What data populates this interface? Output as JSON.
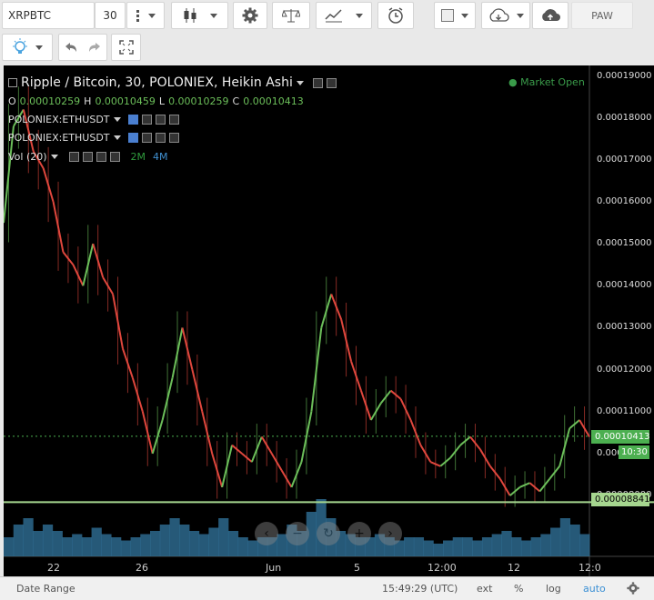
{
  "toolbar": {
    "symbol": "XRPBTC",
    "interval": "30",
    "profile": "PAW"
  },
  "legend": {
    "title": "Ripple / Bitcoin, 30, POLONIEX, Heikin Ashi",
    "ohlc": {
      "o_label": "O",
      "o": "0.00010259",
      "h_label": "H",
      "h": "0.00010459",
      "l_label": "L",
      "l": "0.00010259",
      "c_label": "C",
      "c": "0.00010413"
    },
    "market_status": "Market Open",
    "comparison1": "POLONIEX:ETHUSDT",
    "comparison2": "POLONIEX:ETHUSDT",
    "volume": "Vol (20)",
    "vol_2m": "2M",
    "vol_4m": "4M"
  },
  "price_axis": {
    "labels": [
      "0.00019000",
      "0.00018000",
      "0.00017000",
      "0.00016000",
      "0.00015000",
      "0.00014000",
      "0.00013000",
      "0.00012000",
      "0.00011000",
      "0.000",
      "0.00008000"
    ],
    "last_price": "0.00010413",
    "countdown": "10:30",
    "hline_price": "0.00008841"
  },
  "time_axis": {
    "labels": [
      "22",
      "26",
      "Jun",
      "5",
      "12:00",
      "12",
      "12:0"
    ]
  },
  "bottom": {
    "date_range": "Date Range",
    "clock": "15:49:29 (UTC)",
    "ext": "ext",
    "percent": "%",
    "log": "log",
    "auto": "auto"
  },
  "colors": {
    "up": "#6cbf5a",
    "down": "#e0473d",
    "accent": "#4a7fd0",
    "hline": "#a6d68f",
    "volume": "#2f6f96"
  },
  "chart_data": {
    "type": "line",
    "title": "Ripple / Bitcoin, 30, POLONIEX, Heikin Ashi",
    "xlabel": "",
    "ylabel": "",
    "ylim": [
      7.55e-05,
      0.0001925
    ],
    "x_ticks": [
      "22",
      "26",
      "Jun",
      "5",
      "12:00",
      "12",
      "12:0"
    ],
    "series": [
      {
        "values": [
          0.000155,
          0.000178,
          0.000182,
          0.000172,
          0.000168,
          0.00016,
          0.000148,
          0.000145,
          0.00014,
          0.00015,
          0.000142,
          0.000138,
          0.000125,
          0.000118,
          0.00011,
          0.0001,
          0.000108,
          0.000118,
          0.00013,
          0.00012,
          0.00011,
          0.0001,
          9.2e-05,
          0.000102,
          0.0001,
          9.8e-05,
          0.000104,
          0.0001,
          9.6e-05,
          9.2e-05,
          9.8e-05,
          0.00011,
          0.00013,
          0.000138,
          0.000132,
          0.000122,
          0.000115,
          0.000108,
          0.000112,
          0.000115,
          0.000113,
          0.000108,
          0.000102,
          9.8e-05,
          9.7e-05,
          9.9e-05,
          0.000102,
          0.000104,
          0.000101,
          9.7e-05,
          9.4e-05,
          9e-05,
          9.2e-05,
          9.3e-05,
          9.1e-05,
          9.4e-05,
          9.7e-05,
          0.000106,
          0.000108,
          0.000104
        ]
      }
    ],
    "volume": [
      0.3,
      0.5,
      0.6,
      0.4,
      0.5,
      0.4,
      0.3,
      0.35,
      0.3,
      0.45,
      0.35,
      0.3,
      0.25,
      0.3,
      0.35,
      0.4,
      0.5,
      0.6,
      0.5,
      0.4,
      0.35,
      0.45,
      0.6,
      0.4,
      0.3,
      0.25,
      0.3,
      0.3,
      0.35,
      0.5,
      0.4,
      0.7,
      0.9,
      0.6,
      0.4,
      0.35,
      0.3,
      0.3,
      0.35,
      0.3,
      0.25,
      0.3,
      0.3,
      0.25,
      0.2,
      0.25,
      0.3,
      0.3,
      0.25,
      0.3,
      0.35,
      0.4,
      0.3,
      0.25,
      0.3,
      0.35,
      0.45,
      0.6,
      0.5,
      0.35
    ]
  }
}
